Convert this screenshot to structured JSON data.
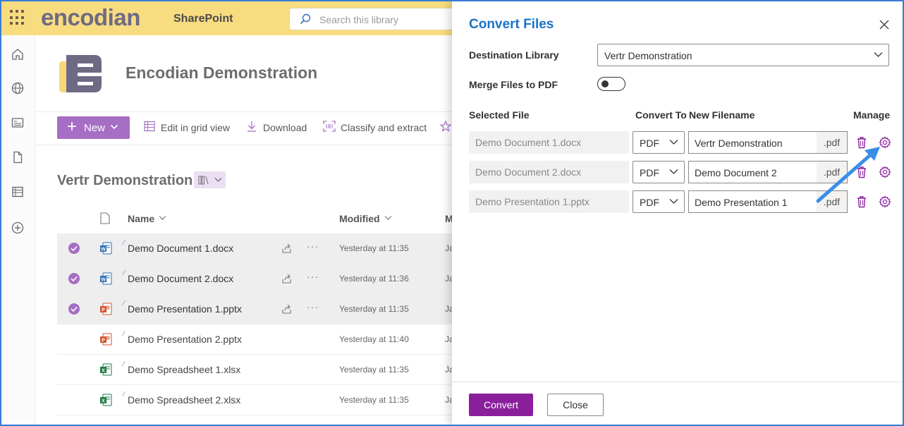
{
  "suitebar": {
    "logo": "encodian",
    "app": "SharePoint",
    "search_placeholder": "Search this library"
  },
  "site": {
    "title": "Encodian Demonstration"
  },
  "commands": {
    "new": "New",
    "edit_grid": "Edit in grid view",
    "download": "Download",
    "classify": "Classify and extract"
  },
  "library": {
    "title": "Vertr Demonstration",
    "columns": {
      "name": "Name",
      "modified": "Modified",
      "truncated": "M"
    },
    "rows": [
      {
        "name": "Demo Document 1.docx",
        "modified": "Yesterday at 11:35",
        "trunc": "Ja",
        "type": "word",
        "selected": true
      },
      {
        "name": "Demo Document 2.docx",
        "modified": "Yesterday at 11:36",
        "trunc": "Ja",
        "type": "word",
        "selected": true
      },
      {
        "name": "Demo Presentation 1.pptx",
        "modified": "Yesterday at 11:35",
        "trunc": "Ja",
        "type": "ppt",
        "selected": true
      },
      {
        "name": "Demo Presentation 2.pptx",
        "modified": "Yesterday at 11:40",
        "trunc": "Ja",
        "type": "ppt",
        "selected": false
      },
      {
        "name": "Demo Spreadsheet 1.xlsx",
        "modified": "Yesterday at 11:35",
        "trunc": "Ja",
        "type": "excel",
        "selected": false
      },
      {
        "name": "Demo Spreadsheet 2.xlsx",
        "modified": "Yesterday at 11:35",
        "trunc": "Ja",
        "type": "excel",
        "selected": false
      }
    ]
  },
  "panel": {
    "title": "Convert Files",
    "destination_label": "Destination Library",
    "destination_value": "Vertr Demonstration",
    "merge_label": "Merge Files to PDF",
    "merge_on": false,
    "headers": {
      "selected": "Selected File",
      "convert_to": "Convert To",
      "new_filename": "New Filename",
      "manage": "Manage"
    },
    "files": [
      {
        "selected": "Demo Document 1.docx",
        "format": "PDF",
        "new_name": "Vertr Demonstration",
        "ext": ".pdf"
      },
      {
        "selected": "Demo Document 2.docx",
        "format": "PDF",
        "new_name": "Demo Document 2",
        "ext": ".pdf"
      },
      {
        "selected": "Demo Presentation 1.pptx",
        "format": "PDF",
        "new_name": "Demo Presentation 1",
        "ext": ".pdf"
      }
    ],
    "convert_button": "Convert",
    "close_button": "Close"
  },
  "colors": {
    "suitebar": "#f8dc80",
    "accent": "#a66ec4",
    "primary_button": "#8a1f9c",
    "panel_title": "#1a73c6",
    "annotation_arrow": "#3a8ee6"
  }
}
